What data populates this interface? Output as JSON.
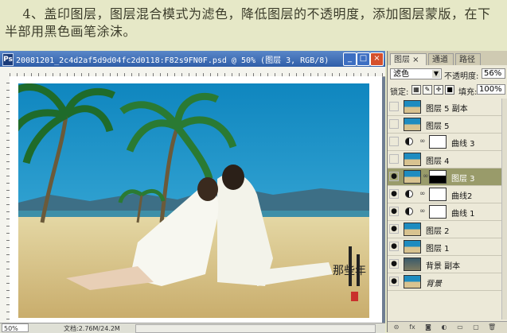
{
  "instruction": {
    "text": "    4、盖印图层，图层混合模式为滤色，降低图层的不透明度，添加图层蒙版，在下半部用黑色画笔涂沫。"
  },
  "document": {
    "title": "20081201_2c4d2af5d9d04fc2d0118:F82s9FN0F.psd @ 50% (图层 3, RGB/8)",
    "ps_logo": "Ps",
    "btn_min": "_",
    "btn_max": "□",
    "btn_close": "×",
    "zoom": "50%",
    "doc_info": "文档:2.76M/24.2M",
    "watermark": "那些年"
  },
  "panel": {
    "tabs": [
      {
        "label": "图层 ×"
      },
      {
        "label": "通道"
      },
      {
        "label": "路径"
      }
    ],
    "blend_mode": "滤色",
    "opacity_label": "不透明度:",
    "opacity_value": "56%",
    "lock_label": "锁定:",
    "fill_label": "填充:",
    "fill_value": "100%",
    "layers": [
      {
        "name": "图层 5 副本",
        "visible": false,
        "thumb": "photo"
      },
      {
        "name": "图层 5",
        "visible": false,
        "thumb": "photo"
      },
      {
        "name": "曲线 3",
        "visible": false,
        "thumb": "adjust"
      },
      {
        "name": "图层 4",
        "visible": false,
        "thumb": "photo"
      },
      {
        "name": "图层 3",
        "visible": true,
        "thumb": "photo",
        "selected": true
      },
      {
        "name": "曲线2",
        "visible": true,
        "thumb": "adjust"
      },
      {
        "name": "曲线 1",
        "visible": true,
        "thumb": "adjust"
      },
      {
        "name": "图层 2",
        "visible": true,
        "thumb": "photo"
      },
      {
        "name": "图层 1",
        "visible": true,
        "thumb": "photo"
      },
      {
        "name": "背景 副本",
        "visible": true,
        "thumb": "dark"
      },
      {
        "name": "背景",
        "visible": true,
        "thumb": "photo"
      }
    ],
    "eye_glyph": "●",
    "bottom_icons": [
      "⊝",
      "fx",
      "◙",
      "◐",
      "▭",
      "▢",
      "🗑"
    ]
  }
}
